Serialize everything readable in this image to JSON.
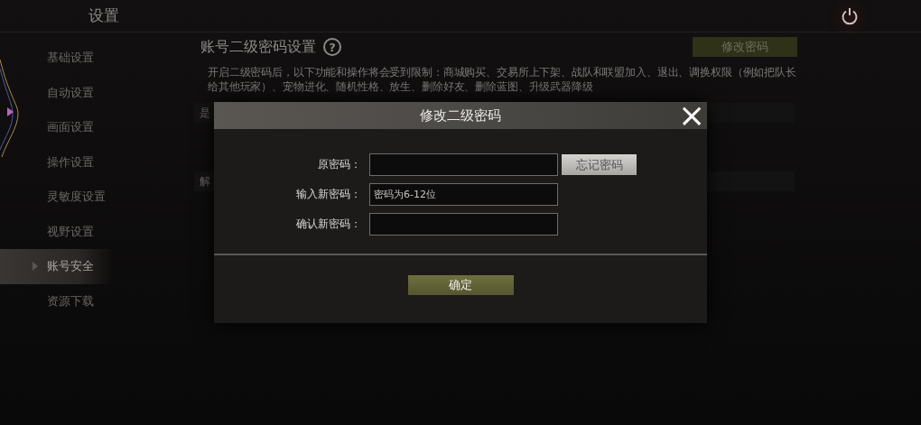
{
  "header": {
    "title": "设置"
  },
  "sidebar": {
    "items": [
      {
        "label": "基础设置",
        "selected": false
      },
      {
        "label": "自动设置",
        "selected": false
      },
      {
        "label": "画面设置",
        "selected": false
      },
      {
        "label": "操作设置",
        "selected": false
      },
      {
        "label": "灵敏度设置",
        "selected": false
      },
      {
        "label": "视野设置",
        "selected": false
      },
      {
        "label": "账号安全",
        "selected": true
      },
      {
        "label": "资源下载",
        "selected": false
      }
    ]
  },
  "content": {
    "title": "账号二级密码设置",
    "help": "?",
    "action_button": "修改密码",
    "description": "开启二级密码后，以下功能和操作将会受到限制：商城购买、交易所上下架、战队和联盟加入、退出、调换权限（例如把队长给其他玩家）、宠物进化、随机性格、放生、删除好友、删除蓝图、升级武器降级",
    "rows": [
      {
        "label": "是"
      },
      {
        "label": "解"
      }
    ]
  },
  "dialog": {
    "title": "修改二级密码",
    "close": "×",
    "fields": [
      {
        "label": "原密码：",
        "side_button": "忘记密码"
      },
      {
        "label": "输入新密码：",
        "placeholder": "密码为6-12位"
      },
      {
        "label": "确认新密码："
      }
    ],
    "confirm_button": "确定"
  }
}
